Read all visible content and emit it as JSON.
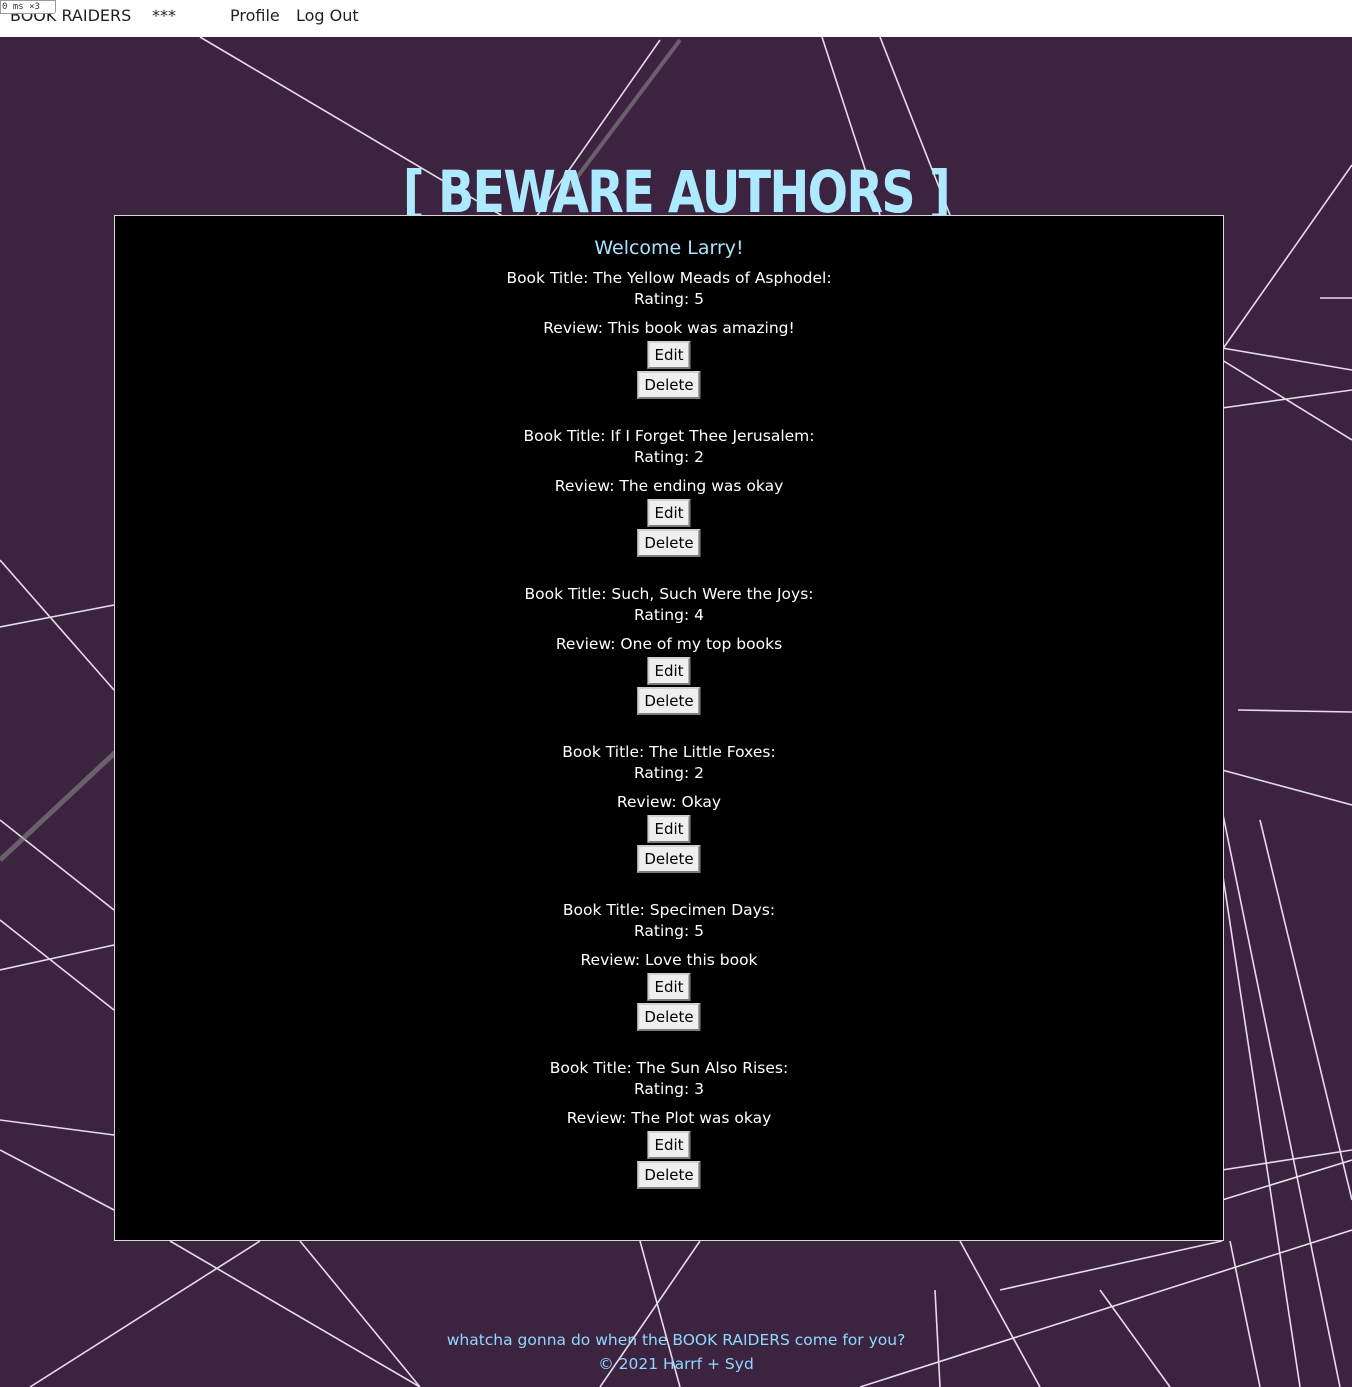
{
  "perf_badge": "0 ms ×3",
  "nav": {
    "brand": "BOOK RAIDERS",
    "stars": "***",
    "profile": "Profile",
    "logout": "Log Out"
  },
  "hero": {
    "title": "[ BEWARE AUTHORS ]"
  },
  "panel": {
    "welcome": "Welcome Larry!",
    "edit_label": "Edit",
    "delete_label": "Delete",
    "reviews": [
      {
        "title": "Book Title: The Yellow Meads of Asphodel:",
        "rating": "Rating: 5",
        "review": "Review: This book was amazing!"
      },
      {
        "title": "Book Title: If I Forget Thee Jerusalem:",
        "rating": "Rating: 2",
        "review": "Review: The ending was okay"
      },
      {
        "title": "Book Title: Such, Such Were the Joys:",
        "rating": "Rating: 4",
        "review": "Review: One of my top books"
      },
      {
        "title": "Book Title: The Little Foxes:",
        "rating": "Rating: 2",
        "review": "Review: Okay"
      },
      {
        "title": "Book Title: Specimen Days:",
        "rating": "Rating: 5",
        "review": "Review: Love this book"
      },
      {
        "title": "Book Title: The Sun Also Rises:",
        "rating": "Rating: 3",
        "review": "Review: The Plot was okay"
      }
    ]
  },
  "footer": {
    "tagline": "whatcha gonna do when the BOOK RAIDERS come for you?",
    "copyright": "© 2021 Harrf + Syd"
  },
  "colors": {
    "background": "#3c233f",
    "title_accent": "#aeeaff",
    "panel": "#000000",
    "footer_text": "#8fd8ff"
  }
}
